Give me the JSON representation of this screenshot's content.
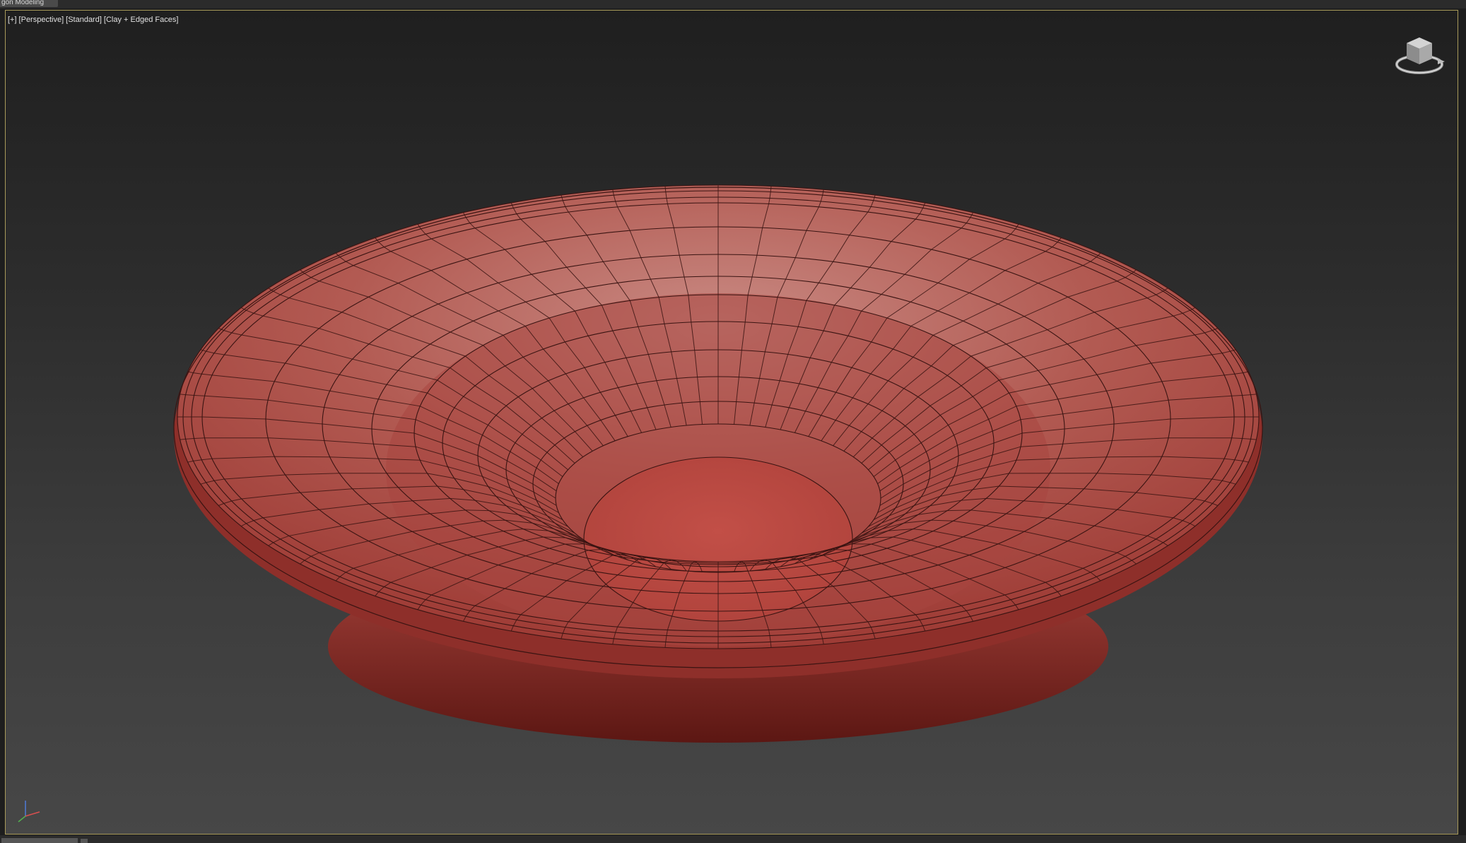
{
  "app": {
    "ribbon_tab_label": "gon Modeling",
    "bottom_tab_label": ""
  },
  "viewport": {
    "label_parts": [
      "[+]",
      "[Perspective]",
      "[Standard]",
      "[Clay + Edged Faces]"
    ],
    "border_color": "#a89a5a",
    "background_top": "#1f1f1f",
    "background_bottom": "#474747"
  },
  "object": {
    "kind": "bowl",
    "material_color": "#b8504a",
    "wire_color": "#3a1412",
    "segments": 64
  },
  "icons": {
    "navigation": "viewcube-icon",
    "axis": "axis-tripod-icon"
  }
}
